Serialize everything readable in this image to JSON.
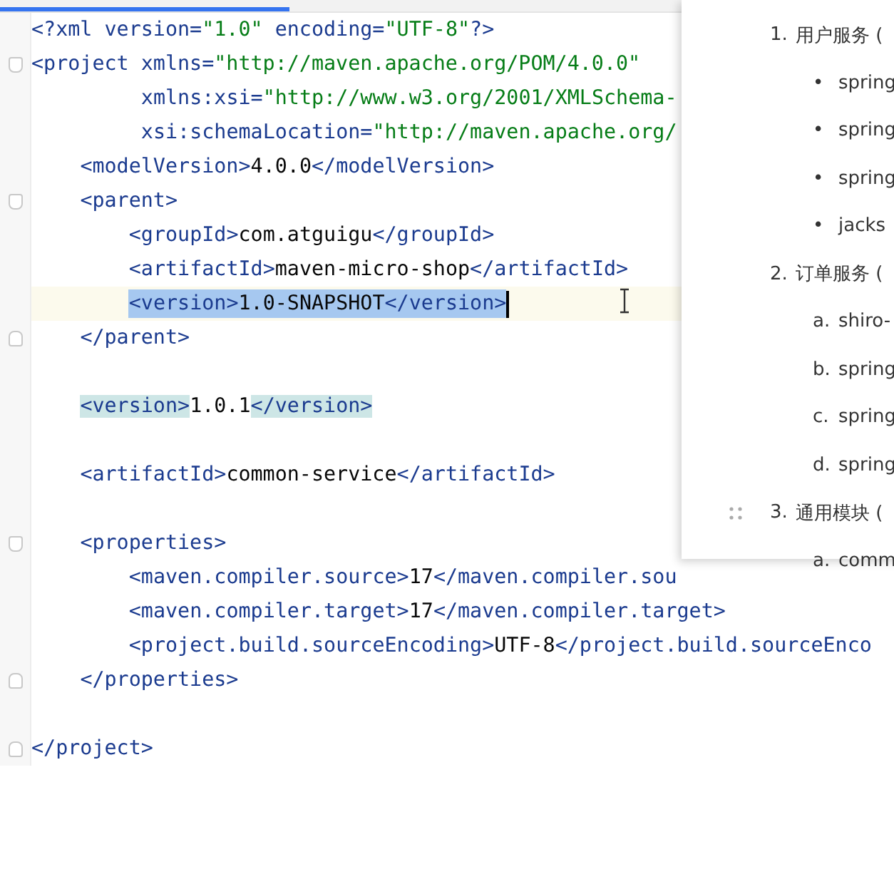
{
  "editor": {
    "lines": [
      {
        "kind": "root",
        "tokens": [
          {
            "kind": "tag",
            "t": "<?xml version="
          },
          {
            "kind": "str",
            "t": "\"1.0\""
          },
          {
            "kind": "tag",
            "t": " encoding="
          },
          {
            "kind": "str",
            "t": "\"UTF-8\""
          },
          {
            "kind": "tag",
            "t": "?>"
          }
        ]
      },
      {
        "kind": "root",
        "fold_open": true,
        "tokens": [
          {
            "kind": "tag",
            "t": "<project xmlns="
          },
          {
            "kind": "str",
            "t": "\"http://maven.apache.org/POM/4.0.0\""
          }
        ]
      },
      {
        "kind": "attribute",
        "tokens": [
          {
            "kind": "tag",
            "t": "xmlns:xsi="
          },
          {
            "kind": "str",
            "t": "\"http://www.w3.org/2001/XMLSchema-"
          }
        ]
      },
      {
        "kind": "attribute",
        "tokens": [
          {
            "kind": "tag",
            "t": "xsi:schemaLocation="
          },
          {
            "kind": "str",
            "t": "\"http://maven.apache.org/"
          }
        ]
      },
      {
        "kind": "child",
        "tokens": [
          {
            "kind": "tag",
            "t": "<modelVersion>"
          },
          {
            "kind": "text",
            "t": "4.0.0"
          },
          {
            "kind": "tag",
            "t": "</modelVersion>"
          }
        ]
      },
      {
        "kind": "child",
        "fold_open": true,
        "tokens": [
          {
            "kind": "tag",
            "t": "<parent>"
          }
        ]
      },
      {
        "kind": "grandchild",
        "tokens": [
          {
            "kind": "tag",
            "t": "<groupId>"
          },
          {
            "kind": "text",
            "t": "com.atguigu"
          },
          {
            "kind": "tag",
            "t": "</groupId>"
          }
        ]
      },
      {
        "kind": "grandchild",
        "tokens": [
          {
            "kind": "tag",
            "t": "<artifactId>"
          },
          {
            "kind": "text",
            "t": "maven-micro-shop"
          },
          {
            "kind": "tag",
            "t": "</artifactId>"
          }
        ]
      },
      {
        "kind": "grandchild",
        "current": true,
        "selected": true,
        "caret": true,
        "tokens": [
          {
            "kind": "tag",
            "t": "<version>"
          },
          {
            "kind": "text",
            "t": "1.0-SNAPSHOT"
          },
          {
            "kind": "tag",
            "t": "</version>"
          }
        ]
      },
      {
        "kind": "child",
        "fold_close": true,
        "tokens": [
          {
            "kind": "tag",
            "t": "</parent>"
          }
        ]
      },
      {
        "kind": "blank"
      },
      {
        "kind": "child",
        "tokens": [
          {
            "kind": "tag",
            "t": "<version>",
            "match": true
          },
          {
            "kind": "text",
            "t": "1.0.1"
          },
          {
            "kind": "tag",
            "t": "</version>",
            "match": true
          }
        ]
      },
      {
        "kind": "blank"
      },
      {
        "kind": "child",
        "tokens": [
          {
            "kind": "tag",
            "t": "<artifactId>"
          },
          {
            "kind": "text",
            "t": "common-service"
          },
          {
            "kind": "tag",
            "t": "</artifactId>"
          }
        ]
      },
      {
        "kind": "blank"
      },
      {
        "kind": "child",
        "fold_open": true,
        "tokens": [
          {
            "kind": "tag",
            "t": "<properties>"
          }
        ]
      },
      {
        "kind": "grandchild",
        "tokens": [
          {
            "kind": "tag",
            "t": "<maven.compiler.source>"
          },
          {
            "kind": "text",
            "t": "17"
          },
          {
            "kind": "tag",
            "t": "</maven.compiler.sou"
          }
        ]
      },
      {
        "kind": "grandchild",
        "tokens": [
          {
            "kind": "tag",
            "t": "<maven.compiler.target>"
          },
          {
            "kind": "text",
            "t": "17"
          },
          {
            "kind": "tag",
            "t": "</maven.compiler.target>"
          }
        ]
      },
      {
        "kind": "grandchild",
        "tokens": [
          {
            "kind": "tag",
            "t": "<project.build.sourceEncoding>"
          },
          {
            "kind": "text",
            "t": "UTF-8"
          },
          {
            "kind": "tag",
            "t": "</project.build.sourceEnco"
          }
        ]
      },
      {
        "kind": "child",
        "fold_close": true,
        "tokens": [
          {
            "kind": "tag",
            "t": "</properties>"
          }
        ]
      },
      {
        "kind": "blank"
      },
      {
        "kind": "root",
        "fold_close": true,
        "tokens": [
          {
            "kind": "tag",
            "t": "</project>"
          }
        ]
      }
    ]
  },
  "notes": {
    "sections": [
      {
        "marker": "1.",
        "title": "用户服务 (",
        "items": [
          {
            "marker": "•",
            "text": "spring"
          },
          {
            "marker": "•",
            "text": "spring"
          },
          {
            "marker": "•",
            "text": "spring"
          },
          {
            "marker": "•",
            "text": "jacks"
          }
        ]
      },
      {
        "marker": "2.",
        "title": "订单服务 (",
        "items": [
          {
            "marker": "a.",
            "text": "shiro-"
          },
          {
            "marker": "b.",
            "text": "spring"
          },
          {
            "marker": "c.",
            "text": "spring"
          },
          {
            "marker": "d.",
            "text": "spring"
          }
        ]
      },
      {
        "marker": "3.",
        "title": "通用模块 (",
        "handle": true,
        "items": [
          {
            "marker": "a.",
            "text": "comm"
          }
        ]
      }
    ]
  }
}
